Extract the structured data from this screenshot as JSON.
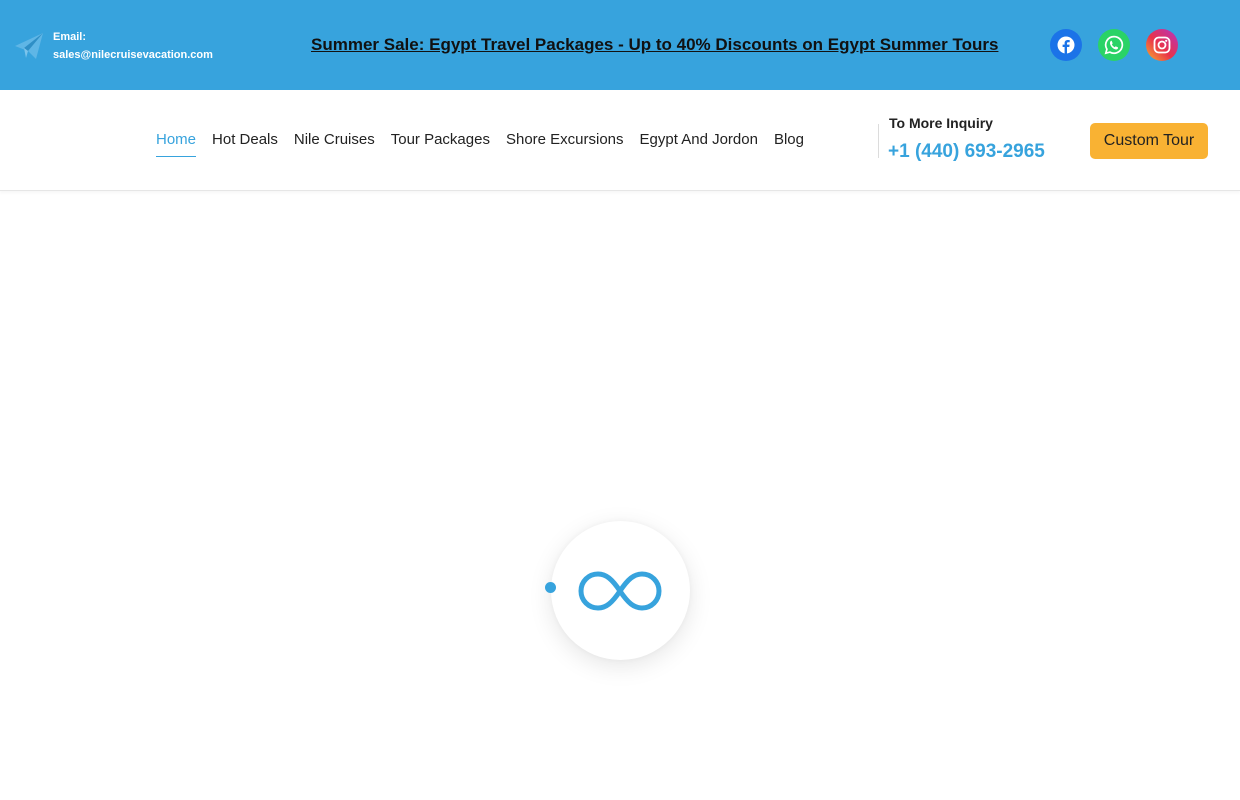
{
  "topbar": {
    "email_label": "Email:",
    "email_value": "sales@nilecruisevacation.com",
    "promo_text": "Summer Sale: Egypt Travel Packages - Up to 40% Discounts on Egypt Summer Tours",
    "background_color": "#37a3dd",
    "social": [
      {
        "name": "facebook-icon",
        "color": "#1b73e8"
      },
      {
        "name": "whatsapp-icon",
        "color": "#2ad366"
      },
      {
        "name": "instagram-icon",
        "color": "#e9334a"
      }
    ]
  },
  "nav": {
    "items": [
      {
        "label": "Home",
        "active": true
      },
      {
        "label": "Hot Deals",
        "active": false
      },
      {
        "label": "Nile Cruises",
        "active": false
      },
      {
        "label": "Tour Packages",
        "active": false
      },
      {
        "label": "Shore Excursions",
        "active": false
      },
      {
        "label": "Egypt And Jordon",
        "active": false
      },
      {
        "label": "Blog",
        "active": false
      }
    ],
    "accent_color": "#37a3dd"
  },
  "inquiry": {
    "label": "To More Inquiry",
    "phone": "+1 (440) 693-2965"
  },
  "cta": {
    "label": "Custom Tour",
    "color": "#f9b233"
  },
  "loader": {
    "icon": "infinity-icon",
    "color": "#37a3dd"
  }
}
